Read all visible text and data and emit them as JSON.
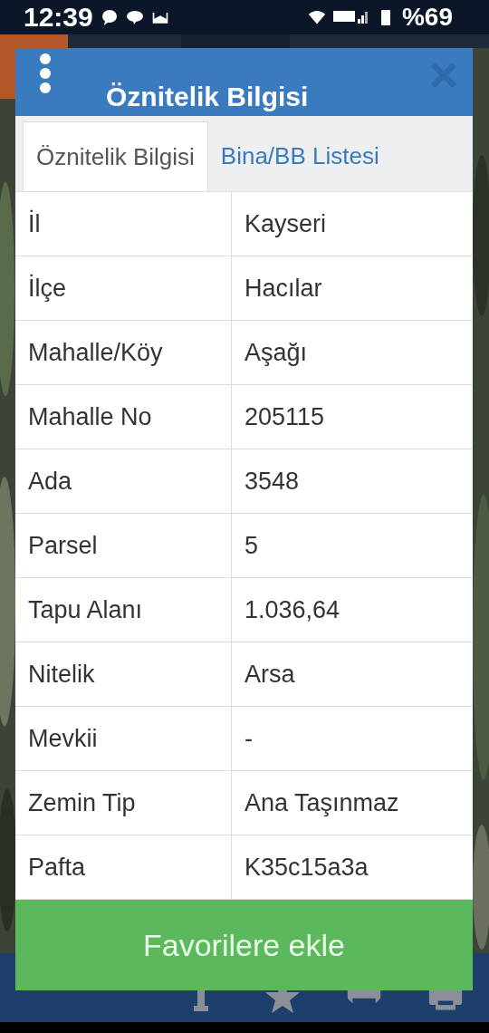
{
  "status_bar": {
    "time": "12:39",
    "battery": "%69"
  },
  "dialog": {
    "title": "Öznitelik Bilgisi",
    "tabs": [
      {
        "label": "Öznitelik Bilgisi",
        "selected": true
      },
      {
        "label": "Bina/BB Listesi",
        "selected": false
      }
    ],
    "rows": [
      {
        "label": "İl",
        "value": "Kayseri"
      },
      {
        "label": "İlçe",
        "value": "Hacılar"
      },
      {
        "label": "Mahalle/Köy",
        "value": "Aşağı"
      },
      {
        "label": "Mahalle No",
        "value": "205115"
      },
      {
        "label": "Ada",
        "value": "3548"
      },
      {
        "label": "Parsel",
        "value": "5"
      },
      {
        "label": "Tapu Alanı",
        "value": "1.036,64"
      },
      {
        "label": "Nitelik",
        "value": "Arsa"
      },
      {
        "label": "Mevkii",
        "value": "-"
      },
      {
        "label": "Zemin Tip",
        "value": "Ana Taşınmaz"
      },
      {
        "label": "Pafta",
        "value": "K35c15a3a"
      }
    ],
    "button": "Favorilere ekle"
  }
}
